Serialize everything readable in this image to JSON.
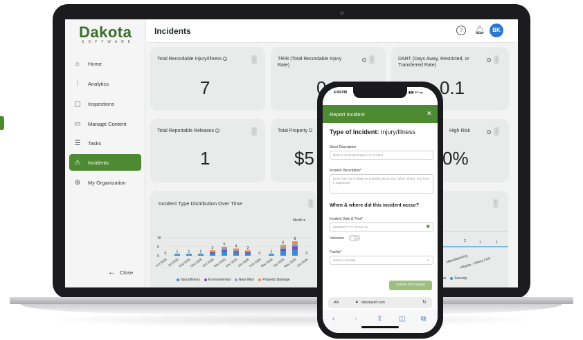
{
  "sidebar": {
    "logo": "Dakota",
    "logo_sub": "SOFTWARE",
    "items": [
      {
        "label": "Home",
        "icon": "home-icon"
      },
      {
        "label": "Analytics",
        "icon": "analytics-icon"
      },
      {
        "label": "Inspections",
        "icon": "inspections-icon"
      },
      {
        "label": "Manage Content",
        "icon": "folder-icon"
      },
      {
        "label": "Tasks",
        "icon": "tasks-icon"
      },
      {
        "label": "Incidents",
        "icon": "warning-icon",
        "active": true
      },
      {
        "label": "My Organization",
        "icon": "globe-icon"
      }
    ],
    "close_label": "Close"
  },
  "header": {
    "title": "Incidents",
    "avatar_initials": "BK"
  },
  "cards": [
    {
      "title": "Total Recordable Injury/Illness",
      "value": "7"
    },
    {
      "title": "TRIR (Total Recordable Injury Rate)",
      "value": "0.5"
    },
    {
      "title": "DART (Days Away, Restricted, or Transferred Rate)",
      "value": "0.1"
    },
    {
      "title": "Total Reportable Releases",
      "value": "1"
    },
    {
      "title": "Total Property D",
      "value": "$5"
    },
    {
      "title": "High Risk",
      "value": "0%"
    }
  ],
  "chart": {
    "title": "Incident Type Distribution Over Time",
    "period_select": "Month",
    "legend": [
      {
        "name": "Injury/Illness",
        "color": "#2e8fd8"
      },
      {
        "name": "Environmental",
        "color": "#7a4fb0"
      },
      {
        "name": "Near Miss",
        "color": "#8aa0b8"
      },
      {
        "name": "Property Damage",
        "color": "#f08a3a"
      }
    ],
    "right_legend": [
      {
        "name": "Miss",
        "color": "#8aa0b8"
      },
      {
        "name": "Security",
        "color": "#2e8fd8"
      }
    ],
    "right_labels": [
      "Manufacturing",
      "Atlanta - Heavy Civil"
    ],
    "right_values": [
      "2",
      "1",
      "1"
    ]
  },
  "chart_data": {
    "type": "bar",
    "categories": [
      "Jun 2025",
      "Jul 2025",
      "Aug 2025",
      "Sep 2025",
      "Oct 2025",
      "Nov 2025",
      "Dec 2025",
      "Jan 2026",
      "Feb 2026",
      "Mar 2026",
      "Apr 2026",
      "May 2026",
      "Jun 2026"
    ],
    "values": [
      0,
      1,
      1,
      1,
      3,
      5,
      4,
      3,
      0,
      1,
      6,
      8,
      0
    ],
    "title": "Incident Type Distribution Over Time",
    "ylim": [
      0,
      10
    ],
    "yticks": [
      0,
      5,
      10
    ]
  },
  "phone": {
    "time": "4:04 PM",
    "status_right": "5G",
    "modal_title": "Report Incident",
    "type_label": "Type of Incident:",
    "type_value": "Injury/Illness",
    "short_desc_label": "Short Description",
    "short_desc_placeholder": "Enter a short description of incident",
    "desc_label": "Incident Description*",
    "desc_placeholder": "Enter has much detail as possible about who, what, where, and how it happened",
    "when_where_heading": "When & where did this incident occur?",
    "date_label": "Incident Date & Time*",
    "date_placeholder": "MM/DD/YYYY hh:mm aa",
    "unknown_label": "Unknown",
    "facility_label": "Facility*",
    "facility_placeholder": "Select a Facility",
    "submit_label": "Submit First Report",
    "url_aa": "AA",
    "url": "dakotasoft.com"
  }
}
